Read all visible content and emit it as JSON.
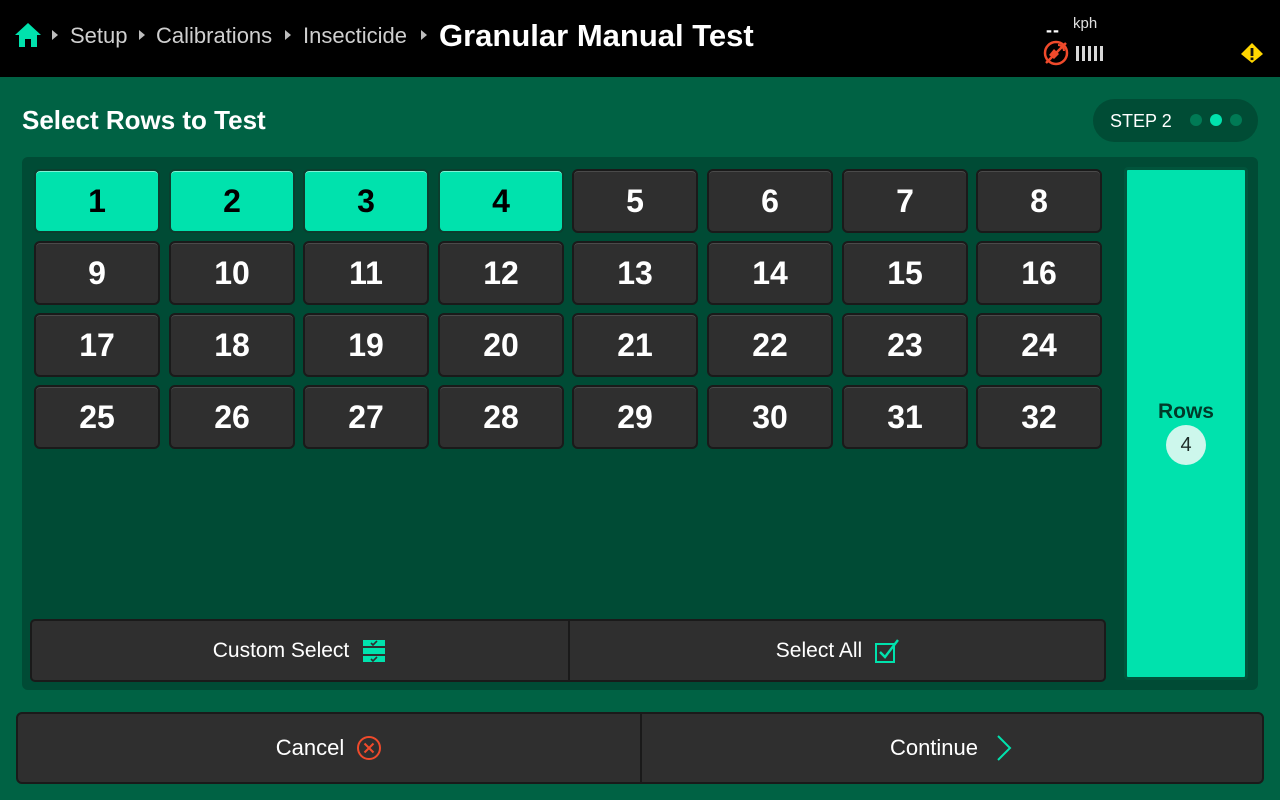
{
  "header": {
    "breadcrumbs": [
      "Setup",
      "Calibrations",
      "Insecticide"
    ],
    "title": "Granular Manual Test",
    "speed_value": "--",
    "speed_unit": "kph"
  },
  "page": {
    "section_title": "Select Rows to Test",
    "step_label": "STEP 2",
    "step_current": 2,
    "step_total": 3
  },
  "rows": {
    "items": [
      "1",
      "2",
      "3",
      "4",
      "5",
      "6",
      "7",
      "8",
      "9",
      "10",
      "11",
      "12",
      "13",
      "14",
      "15",
      "16",
      "17",
      "18",
      "19",
      "20",
      "21",
      "22",
      "23",
      "24",
      "25",
      "26",
      "27",
      "28",
      "29",
      "30",
      "31",
      "32"
    ],
    "selected": [
      "1",
      "2",
      "3",
      "4"
    ]
  },
  "actions": {
    "custom_select": "Custom Select",
    "select_all": "Select All"
  },
  "summary": {
    "label": "Rows",
    "count": "4"
  },
  "footer": {
    "cancel": "Cancel",
    "continue": "Continue"
  },
  "colors": {
    "background": "#006244",
    "accent": "#00e2ad",
    "button": "#2f2f2f",
    "warning": "#ffd600",
    "gps_alert": "#f04a2b"
  }
}
